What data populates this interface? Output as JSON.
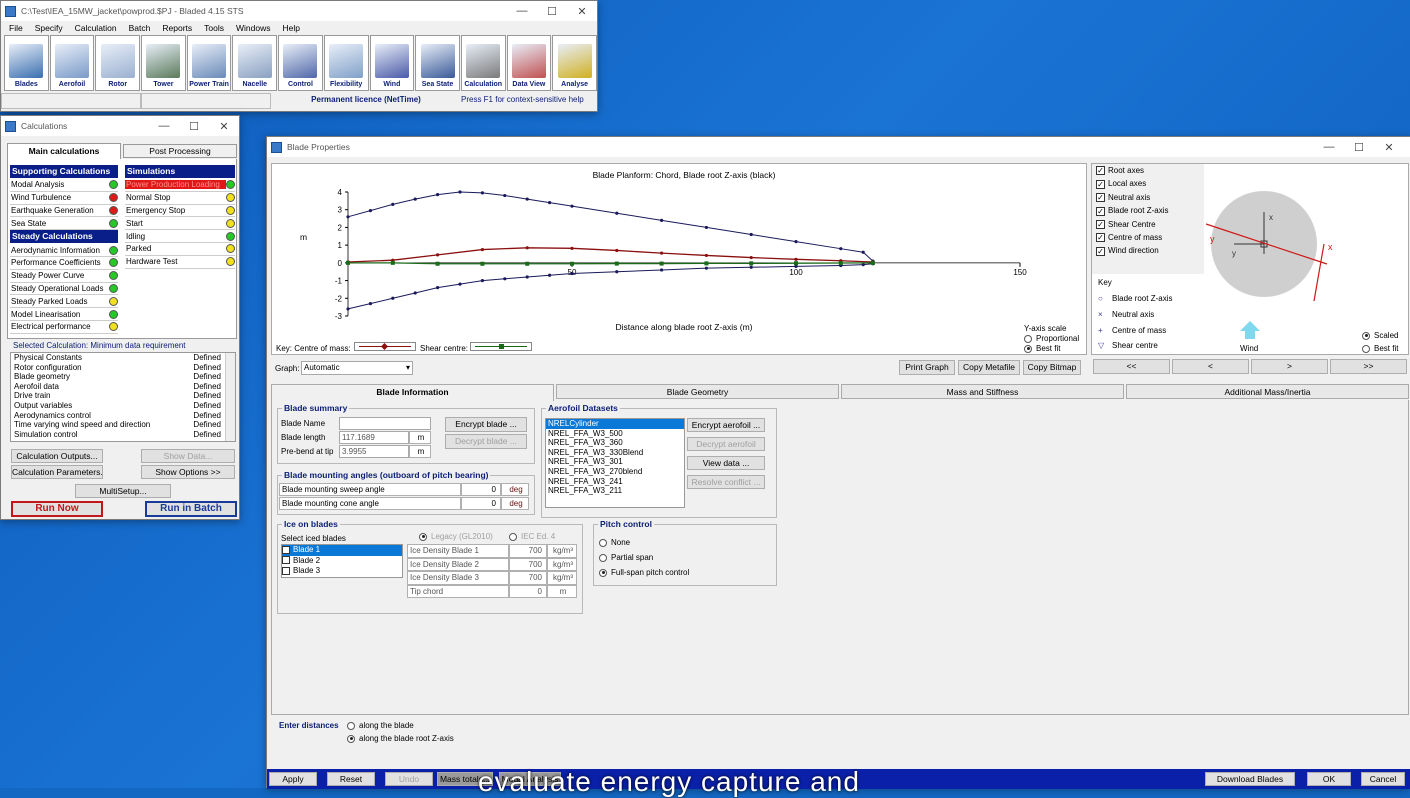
{
  "bladed": {
    "title": "C:\\Test\\IEA_15MW_jacket\\powprod.$PJ - Bladed 4.15 STS",
    "menu": [
      "File",
      "Specify",
      "Calculation",
      "Batch",
      "Reports",
      "Tools",
      "Windows",
      "Help"
    ],
    "toolbar": [
      "Blades",
      "Aerofoil",
      "Rotor",
      "Tower",
      "Power Train",
      "Nacelle",
      "Control",
      "Flexibility",
      "Wind",
      "Sea State",
      "Calculation",
      "Data View",
      "Analyse"
    ],
    "licence": "Permanent licence (NetTime)",
    "help": "Press F1 for context-sensitive help"
  },
  "calc": {
    "title": "Calculations",
    "tabs": [
      "Main calculations",
      "Post Processing"
    ],
    "supporting_header": "Supporting Calculations",
    "supporting": [
      {
        "label": "Modal Analysis",
        "status": "#26c826"
      },
      {
        "label": "Wind Turbulence",
        "status": "#e01818"
      },
      {
        "label": "Earthquake Generation",
        "status": "#e01818"
      },
      {
        "label": "Sea State",
        "status": "#26c826"
      }
    ],
    "steady_header": "Steady Calculations",
    "steady": [
      {
        "label": "Aerodynamic Information",
        "status": "#26c826"
      },
      {
        "label": "Performance Coefficients",
        "status": "#26c826"
      },
      {
        "label": "Steady Power Curve",
        "status": "#26c826"
      },
      {
        "label": "Steady Operational Loads",
        "status": "#26c826"
      },
      {
        "label": "Steady Parked Loads",
        "status": "#f0e020"
      },
      {
        "label": "Model Linearisation",
        "status": "#26c826"
      },
      {
        "label": "Electrical performance",
        "status": "#f0e020"
      }
    ],
    "sim_header": "Simulations",
    "sims": [
      {
        "label": "Power Production Loading",
        "status": "#26c826"
      },
      {
        "label": "Normal Stop",
        "status": "#f0e020"
      },
      {
        "label": "Emergency Stop",
        "status": "#f0e020"
      },
      {
        "label": "Start",
        "status": "#f0e020"
      },
      {
        "label": "Idling",
        "status": "#26c826"
      },
      {
        "label": "Parked",
        "status": "#f0e020"
      },
      {
        "label": "Hardware Test",
        "status": "#f0e020"
      }
    ],
    "selected_title": "Selected Calculation: Minimum data requirement",
    "requirements": [
      {
        "item": "Physical Constants",
        "state": "Defined"
      },
      {
        "item": "Rotor configuration",
        "state": "Defined"
      },
      {
        "item": "Blade geometry",
        "state": "Defined"
      },
      {
        "item": "Aerofoil data",
        "state": "Defined"
      },
      {
        "item": "Drive train",
        "state": "Defined"
      },
      {
        "item": "Output variables",
        "state": "Defined"
      },
      {
        "item": "Aerodynamics control",
        "state": "Defined"
      },
      {
        "item": "Time varying wind speed and direction",
        "state": "Defined"
      },
      {
        "item": "Simulation control",
        "state": "Defined"
      }
    ],
    "buttons": {
      "outputs": "Calculation Outputs...",
      "show_data": "Show Data...",
      "params": "Calculation Parameters...",
      "show_options": "Show Options >>",
      "multisetup": "MultiSetup...",
      "run_now": "Run Now",
      "run_batch": "Run in Batch"
    }
  },
  "blade": {
    "title": "Blade Properties",
    "chart_title": "Blade Planform: Chord, Blade root Z-axis (black)",
    "ylabel": "m",
    "xlabel": "Distance along blade root Z-axis (m)",
    "key_label": "Key: Centre of mass:",
    "shear_label": "Shear centre:",
    "yscale_label": "Y-axis scale",
    "yscale_opts": [
      "Proportional",
      "Best fit"
    ],
    "graph_label": "Graph:",
    "graph_value": "Automatic",
    "graph_buttons": [
      "Print Graph",
      "Copy Metafile",
      "Copy Bitmap"
    ],
    "axes_checks": [
      "Root axes",
      "Local axes",
      "Neutral axis",
      "Blade root Z-axis",
      "Shear Centre",
      "Centre of mass",
      "Wind direction"
    ],
    "key_title": "Key",
    "key_items": [
      {
        "sym": "○",
        "label": "Blade root Z-axis"
      },
      {
        "sym": "×",
        "label": "Neutral axis"
      },
      {
        "sym": "+",
        "label": "Centre of mass"
      },
      {
        "sym": "▽",
        "label": "Shear centre"
      }
    ],
    "wind_label": "Wind",
    "scale_opts": [
      "Scaled",
      "Best fit"
    ],
    "nav": [
      "<<",
      "<",
      ">",
      ">>"
    ],
    "tabs": [
      "Blade Information",
      "Blade Geometry",
      "Mass and Stiffness",
      "Additional Mass/Inertia"
    ],
    "summary": {
      "title": "Blade summary",
      "name_label": "Blade Name",
      "name": "",
      "length_label": "Blade length",
      "length": "117.1689",
      "prebend_label": "Pre-bend at tip",
      "prebend": "3.9955",
      "unit": "m",
      "encrypt": "Encrypt blade ...",
      "decrypt": "Decrypt blade ..."
    },
    "mounting": {
      "title": "Blade mounting angles (outboard of pitch bearing)",
      "rows": [
        {
          "label": "Blade mounting sweep angle",
          "value": "0",
          "unit": "deg"
        },
        {
          "label": "Blade mounting cone angle",
          "value": "0",
          "unit": "deg"
        }
      ]
    },
    "aerofoil": {
      "title": "Aerofoil Datasets",
      "items": [
        "NRELCylinder",
        "NREL_FFA_W3_500",
        "NREL_FFA_W3_360",
        "NREL_FFA_W3_330Blend",
        "NREL_FFA_W3_301",
        "NREL_FFA_W3_270blend",
        "NREL_FFA_W3_241",
        "NREL_FFA_W3_211"
      ],
      "buttons": [
        "Encrypt aerofoil ...",
        "Decrypt aerofoil",
        "View data ...",
        "Resolve conflict ..."
      ]
    },
    "ice": {
      "title": "Ice on blades",
      "select_label": "Select iced blades",
      "blades": [
        "Blade 1",
        "Blade 2",
        "Blade 3"
      ],
      "std": [
        "Legacy (GL2010)",
        "IEC Ed. 4"
      ],
      "rows": [
        {
          "label": "Ice Density Blade 1",
          "value": "700",
          "unit": "kg/m³"
        },
        {
          "label": "Ice Density Blade 2",
          "value": "700",
          "unit": "kg/m³"
        },
        {
          "label": "Ice Density Blade 3",
          "value": "700",
          "unit": "kg/m³"
        },
        {
          "label": "Tip chord",
          "value": "0",
          "unit": "m"
        }
      ]
    },
    "pitch": {
      "title": "Pitch control",
      "opts": [
        "None",
        "Partial span",
        "Full-span pitch control"
      ]
    },
    "enter_label": "Enter distances",
    "enter_opts": [
      "along the blade",
      "along the blade root Z-axis"
    ],
    "bottom_buttons": [
      "Apply",
      "Reset",
      "Undo",
      "Mass totals...",
      "Modal Analysis"
    ],
    "right_buttons": [
      "Download Blades",
      "OK",
      "Cancel"
    ]
  },
  "caption": "evaluate energy capture and",
  "chart_data": {
    "type": "line",
    "title": "Blade Planform: Chord, Blade root Z-axis (black)",
    "xlabel": "Distance along blade root Z-axis (m)",
    "ylabel": "m",
    "xlim": [
      0,
      150
    ],
    "ylim": [
      -3,
      4
    ],
    "xticks": [
      50,
      100,
      150
    ],
    "yticks": [
      4,
      3,
      2,
      1,
      0,
      -1,
      -2,
      -3
    ],
    "series": [
      {
        "name": "",
        "color": "#1a1a5a",
        "x": [
          0,
          5,
          10,
          15,
          20,
          25,
          30,
          35,
          40,
          45,
          50,
          60,
          70,
          80,
          90,
          100,
          110,
          115,
          117.17
        ],
        "y": [
          2.6,
          2.95,
          3.3,
          3.6,
          3.85,
          4.0,
          3.95,
          3.8,
          3.6,
          3.4,
          3.2,
          2.8,
          2.4,
          2.0,
          1.6,
          1.2,
          0.8,
          0.6,
          0.1
        ]
      },
      {
        "name": "",
        "color": "#1a1a5a",
        "x": [
          0,
          5,
          10,
          15,
          20,
          25,
          30,
          35,
          40,
          45,
          50,
          60,
          70,
          80,
          90,
          100,
          110,
          115,
          117.17
        ],
        "y": [
          -2.6,
          -2.3,
          -2.0,
          -1.7,
          -1.4,
          -1.2,
          -1.0,
          -0.9,
          -0.8,
          -0.7,
          -0.6,
          -0.5,
          -0.4,
          -0.3,
          -0.25,
          -0.2,
          -0.15,
          -0.1,
          -0.05
        ]
      },
      {
        "name": "Centre of mass",
        "color": "#8b1010",
        "x": [
          0,
          10,
          20,
          30,
          40,
          50,
          60,
          70,
          80,
          90,
          100,
          110,
          117.17
        ],
        "y": [
          0.05,
          0.15,
          0.45,
          0.75,
          0.85,
          0.82,
          0.7,
          0.55,
          0.42,
          0.3,
          0.2,
          0.12,
          0.05
        ]
      },
      {
        "name": "Shear centre",
        "color": "#1a6a1a",
        "x": [
          0,
          10,
          20,
          30,
          40,
          50,
          60,
          70,
          80,
          90,
          100,
          110,
          117.17
        ],
        "y": [
          0.0,
          0.0,
          -0.05,
          -0.05,
          -0.05,
          -0.05,
          -0.04,
          -0.04,
          -0.03,
          -0.03,
          -0.02,
          -0.01,
          0.0
        ]
      }
    ]
  }
}
